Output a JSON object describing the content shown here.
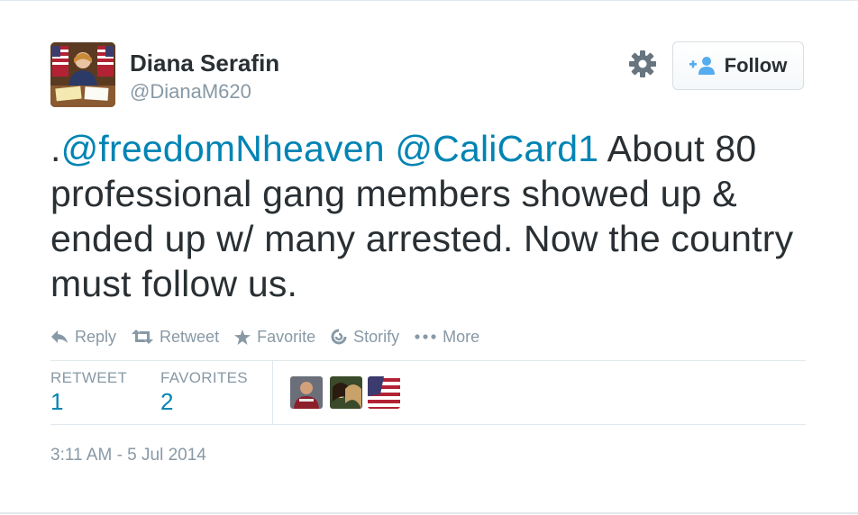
{
  "user": {
    "name": "Diana Serafin",
    "handle": "@DianaM620"
  },
  "follow_button": {
    "label": "Follow"
  },
  "tweet": {
    "prefix": ".",
    "mention_1": "@freedomNheaven",
    "mention_2": "@CaliCard1",
    "body": " About 80 professional gang members showed up & ended up w/ many arrested.  Now the country must follow us."
  },
  "actions": {
    "reply": "Reply",
    "retweet": "Retweet",
    "favorite": "Favorite",
    "storify": "Storify",
    "more": "More"
  },
  "stats": {
    "retweets_label": "RETWEET",
    "retweets_value": "1",
    "favorites_label": "FAVORITES",
    "favorites_value": "2"
  },
  "timestamp": "3:11 AM - 5 Jul 2014",
  "colors": {
    "link": "#0084b4",
    "muted": "#8899a6",
    "text": "#292f33",
    "divider": "#e1e8ed"
  },
  "icons": {
    "settings": "gear-icon",
    "follow": "add-user-icon",
    "reply": "reply-icon",
    "retweet": "retweet-icon",
    "favorite": "star-icon",
    "storify": "storify-icon",
    "more": "more-dots-icon"
  }
}
